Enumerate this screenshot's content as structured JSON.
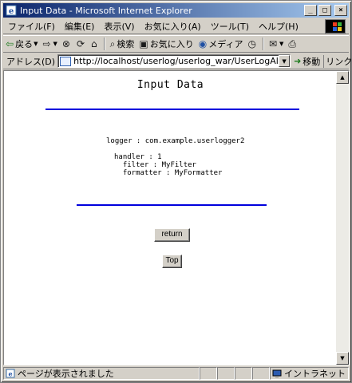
{
  "window": {
    "title": "Input Data - Microsoft Internet Explorer"
  },
  "menu": [
    "ファイル(F)",
    "編集(E)",
    "表示(V)",
    "お気に入り(A)",
    "ツール(T)",
    "ヘルプ(H)"
  ],
  "toolbar": {
    "back_label": "戻る",
    "search_label": "検索",
    "favorites_label": "お気に入り",
    "media_label": "メディア"
  },
  "address": {
    "label": "アドレス(D)",
    "url": "http://localhost/userlog/userlog_war/UserLogAlias",
    "go_label": "移動",
    "links_label": "リンク »"
  },
  "page": {
    "title": "Input Data",
    "logger_line": "logger : com.example.userlogger2",
    "handler_line": "handler : 1",
    "filter_line": "  filter : MyFilter",
    "formatter_line": "  formatter : MyFormatter",
    "return_button": "return",
    "top_button": "Top"
  },
  "status": {
    "text": "ページが表示されました",
    "zone": "イントラネット"
  },
  "colors": {
    "rule": "#0000dd",
    "titlebar_start": "#0a246a",
    "titlebar_end": "#a6caf0"
  }
}
